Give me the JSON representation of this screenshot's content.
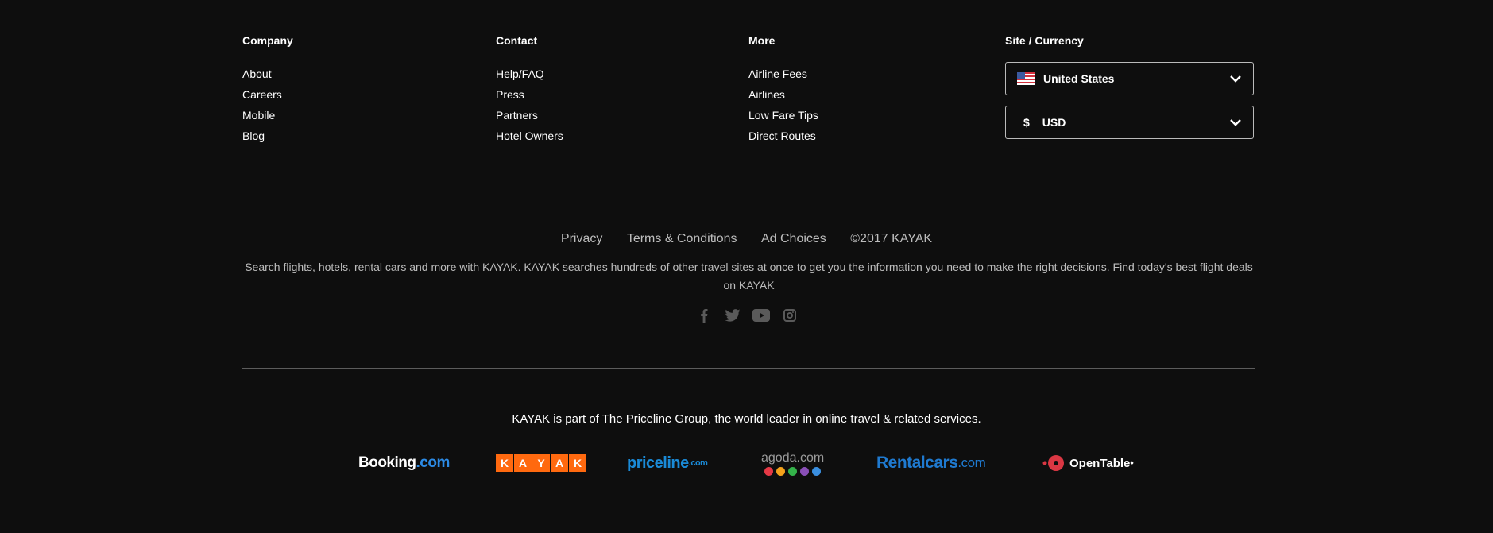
{
  "columns": [
    {
      "title": "Company",
      "items": [
        "About",
        "Careers",
        "Mobile",
        "Blog"
      ]
    },
    {
      "title": "Contact",
      "items": [
        "Help/FAQ",
        "Press",
        "Partners",
        "Hotel Owners"
      ]
    },
    {
      "title": "More",
      "items": [
        "Airline Fees",
        "Airlines",
        "Low Fare Tips",
        "Direct Routes"
      ]
    }
  ],
  "site_currency": {
    "title": "Site / Currency",
    "country": "United States",
    "currency_symbol": "$",
    "currency": "USD"
  },
  "legal_links": [
    "Privacy",
    "Terms & Conditions",
    "Ad Choices",
    "©2017 KAYAK"
  ],
  "description": "Search flights, hotels, rental cars and more with KAYAK. KAYAK searches hundreds of other travel sites at once to get you the information you need to make the right decisions. Find today's best flight deals on KAYAK",
  "social_icons": [
    "facebook-icon",
    "twitter-icon",
    "youtube-icon",
    "instagram-icon"
  ],
  "group_text": "KAYAK is part of The Priceline Group, the world leader in online travel & related services.",
  "brands": {
    "booking": {
      "name": "Booking",
      "suffix": ".com"
    },
    "kayak": [
      "K",
      "A",
      "Y",
      "A",
      "K"
    ],
    "priceline": {
      "name": "priceline",
      "suffix": ".com"
    },
    "agoda": {
      "name": "agoda.com",
      "dot_colors": [
        "#e63946",
        "#f4a21b",
        "#34b34a",
        "#8a4fb7",
        "#3a8fe0"
      ]
    },
    "rentalcars": {
      "name": "Rentalcars",
      "suffix": ".com"
    },
    "opentable": {
      "name": "OpenTable",
      "suffix": "•"
    }
  },
  "colors": {
    "background": "#0e0e0e",
    "kayak_orange": "#ff690f"
  }
}
